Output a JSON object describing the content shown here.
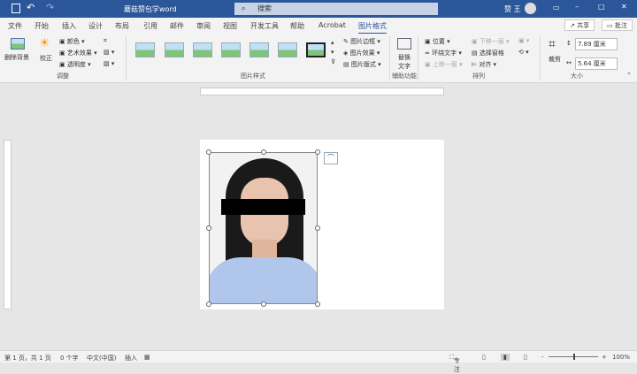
{
  "title": "蘑菇赞包学word",
  "search_placeholder": "搜索",
  "user": "赞 王",
  "tabs": [
    "文件",
    "开始",
    "插入",
    "设计",
    "布局",
    "引用",
    "邮件",
    "审阅",
    "视图",
    "开发工具",
    "帮助",
    "Acrobat",
    "图片格式"
  ],
  "share": "共享",
  "comment": "批注",
  "ribbon": {
    "remove_bg": "删除背景",
    "correct": "校正",
    "color": "颜色",
    "art_effects": "艺术效果",
    "transparency": "透明度",
    "adjust": "调整",
    "pic_border": "图片边框",
    "pic_effects": "图片效果",
    "pic_layout": "图片版式",
    "pic_styles": "图片样式",
    "alt_text": "替换文字",
    "accessibility": "辅助功能",
    "position": "位置",
    "wrap_text": "环绕文字",
    "bring_forward": "上移一层",
    "send_backward": "下移一层",
    "selection_pane": "选择窗格",
    "align": "对齐",
    "arrange": "排列",
    "crop": "裁剪",
    "height": "7.89 厘米",
    "width": "5.64 厘米",
    "size": "大小"
  },
  "status": {
    "page": "第 1 页，共 1 页",
    "words": "0 个字",
    "lang": "中文(中国)",
    "mode": "插入",
    "focus": "专注",
    "zoom": "100%"
  },
  "zoom_percent": 100
}
